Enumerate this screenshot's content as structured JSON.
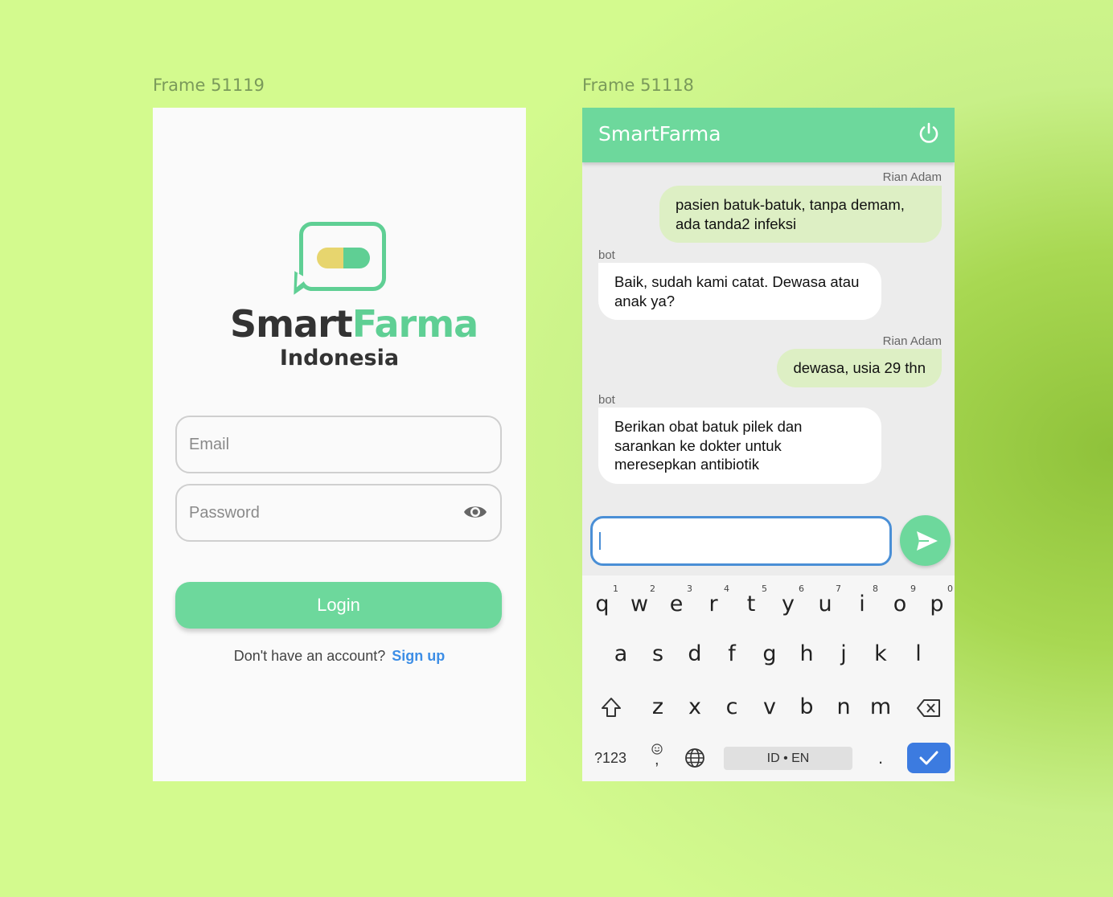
{
  "frames": {
    "login_label": "Frame 51119",
    "chat_label": "Frame 51118"
  },
  "login": {
    "brand_smart": "Smart",
    "brand_farma": "Farma",
    "brand_sub": "Indonesia",
    "email_placeholder": "Email",
    "password_placeholder": "Password",
    "login_label": "Login",
    "signup_prompt": "Don't have an account?",
    "signup_link": "Sign up"
  },
  "chat": {
    "title": "SmartFarma",
    "messages": [
      {
        "sender": "Rian Adam",
        "text": "pasien batuk-batuk, tanpa demam, ada tanda2 infeksi"
      },
      {
        "sender": "bot",
        "text": "Baik, sudah kami catat. Dewasa atau anak ya?"
      },
      {
        "sender": "Rian Adam",
        "text": "dewasa, usia 29 thn"
      },
      {
        "sender": "bot",
        "text": "Berikan obat batuk pilek dan sarankan ke dokter untuk meresepkan antibiotik"
      }
    ]
  },
  "keyboard": {
    "row1": [
      "q",
      "w",
      "e",
      "r",
      "t",
      "y",
      "u",
      "i",
      "o",
      "p"
    ],
    "row1_hints": [
      "1",
      "2",
      "3",
      "4",
      "5",
      "6",
      "7",
      "8",
      "9",
      "0"
    ],
    "row2": [
      "a",
      "s",
      "d",
      "f",
      "g",
      "h",
      "j",
      "k",
      "l"
    ],
    "row3": [
      "z",
      "x",
      "c",
      "v",
      "b",
      "n",
      "m"
    ],
    "symbols_label": "?123",
    "comma_label": ",",
    "period_label": ".",
    "space_label": "ID • EN"
  },
  "colors": {
    "accent": "#6dd89c",
    "link": "#3d8ee6",
    "user_bubble": "#ddefc4",
    "pill_yellow": "#e7d56e"
  }
}
